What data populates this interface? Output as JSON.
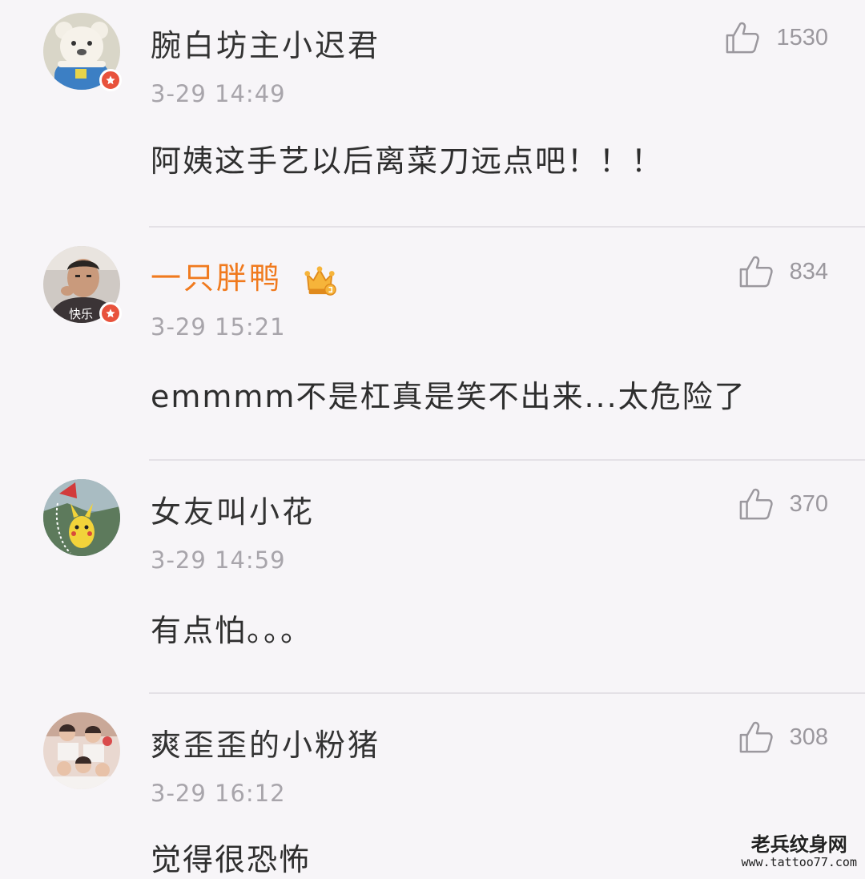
{
  "comments": [
    {
      "username": "腕白坊主小迟君",
      "time": "3-29 14:49",
      "text": "阿姨这手艺以后离菜刀远点吧！！！",
      "likes": "1530",
      "vip": false,
      "avatar_icon": "bear-avatar",
      "verified_badge": true
    },
    {
      "username": "一只胖鸭",
      "time": "3-29 15:21",
      "text": "emmmm不是杠真是笑不出来...太危险了",
      "likes": "834",
      "vip": true,
      "avatar_icon": "man-avatar",
      "avatar_overlay": "快乐",
      "verified_badge": true
    },
    {
      "username": "女友叫小花",
      "time": "3-29 14:59",
      "text": "有点怕。。。",
      "likes": "370",
      "vip": false,
      "avatar_icon": "pikachu-avatar",
      "verified_badge": false
    },
    {
      "username": "爽歪歪的小粉猪",
      "time": "3-29 16:12",
      "text": "觉得很恐怖",
      "likes": "308",
      "vip": false,
      "avatar_icon": "group-photo-avatar",
      "verified_badge": false
    }
  ],
  "watermark": {
    "line1": "老兵纹身网",
    "line2": "www.tattoo77.com"
  },
  "colors": {
    "background": "#f7f5f8",
    "vip_name": "#f07a1e",
    "badge": "#e8523c",
    "muted": "#a8a5ab"
  }
}
